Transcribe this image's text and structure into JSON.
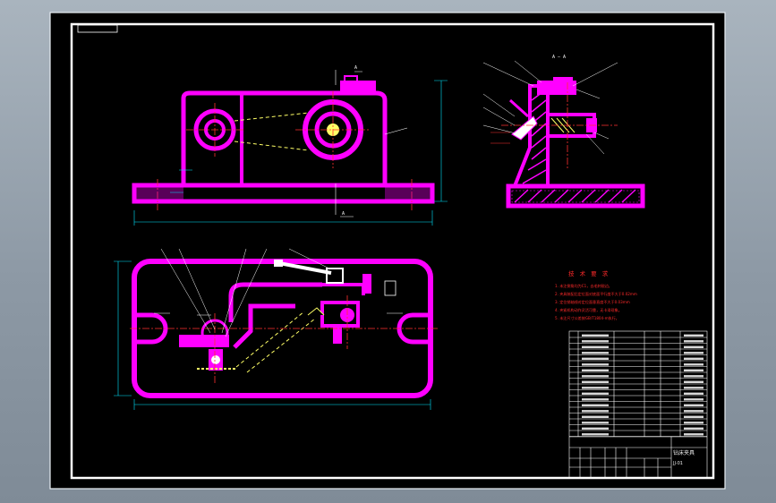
{
  "drawing": {
    "colors": {
      "background": "#000000",
      "part": "#ff00ff",
      "centerline": "#ff3030",
      "dimension": "#00e5ff",
      "hidden": "#ffff66",
      "table": "#ffffff",
      "tech_text": "#ff2a2a"
    },
    "section_label": "A — A",
    "section_mark": "A",
    "tech_title": "技 术 要 求",
    "tech_lines": [
      "1. 未注倒角均为C1，去毛刺锐边。",
      "2. 夹具装配后定位面对底面平行度不大于0.02mm",
      "3. 定位销轴线对定位面垂直度不大于0.03mm",
      "4. 夹紧机构动作灵活可靠，无卡滞现象。",
      "5. 未注尺寸公差按GB/T1804-m执行。"
    ],
    "title_block": {
      "name": "钻床夹具",
      "drawing_no": "JJ-01"
    }
  }
}
